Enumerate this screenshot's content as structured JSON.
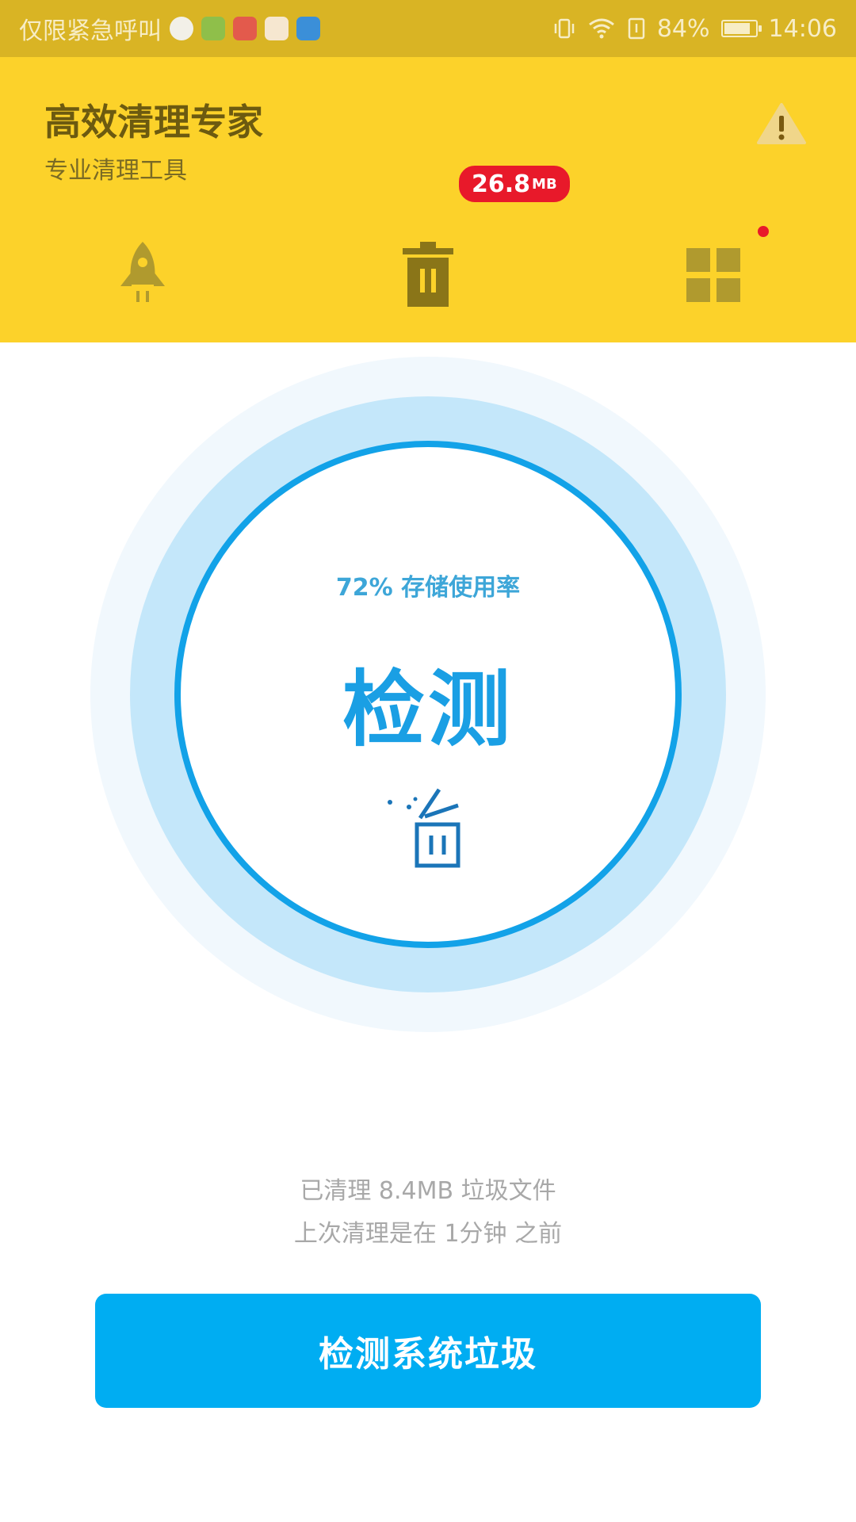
{
  "status_bar": {
    "carrier_text": "仅限紧急呼叫",
    "battery_percent": "84%",
    "battery_level": 0.84,
    "time": "14:06",
    "notification_icons": [
      "wechat-icon",
      "android-icon",
      "calendar-icon",
      "calendar-icon",
      "browser-icon"
    ],
    "colors": {
      "background": "#d9b424"
    }
  },
  "header": {
    "title": "高效清理专家",
    "subtitle": "专业清理工具",
    "warning_icon": "warning-icon",
    "colors": {
      "background": "#fcd22a",
      "title": "#6c5a10"
    }
  },
  "nav": {
    "items": [
      {
        "name": "boost",
        "icon": "rocket-icon"
      },
      {
        "name": "clean",
        "icon": "trash-icon"
      },
      {
        "name": "apps",
        "icon": "grid-icon"
      }
    ],
    "badge_value": "26.8",
    "badge_unit": "MB",
    "colors": {
      "badge": "#e8192a"
    }
  },
  "scan_circle": {
    "usage_label": "72% 存储使用率",
    "storage_usage_percent": 72,
    "action_label": "检测",
    "icon": "broom-bin-icon",
    "colors": {
      "ring": "#12a2e8",
      "text": "#1a9fe4"
    }
  },
  "info": {
    "cleaned_line": "已清理 8.4MB 垃圾文件",
    "last_clean_line": "上次清理是在 1分钟 之前"
  },
  "primary_button": {
    "label": "检测系统垃圾",
    "colors": {
      "background": "#00adf2"
    }
  }
}
